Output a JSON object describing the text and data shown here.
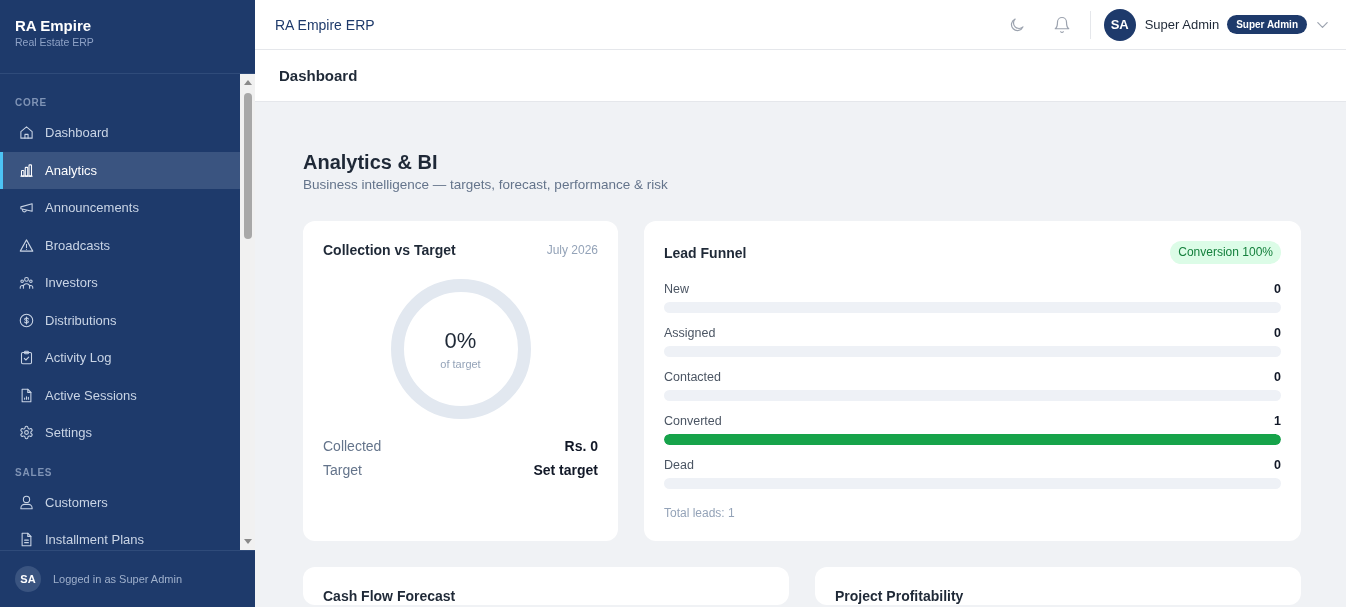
{
  "sidebar": {
    "brand": {
      "title": "RA Empire",
      "subtitle": "Real Estate ERP"
    },
    "sections": [
      {
        "label": "CORE",
        "items": [
          {
            "label": "Dashboard",
            "selected": false
          },
          {
            "label": "Analytics",
            "selected": true
          },
          {
            "label": "Announcements",
            "selected": false
          },
          {
            "label": "Broadcasts",
            "selected": false
          },
          {
            "label": "Investors",
            "selected": false
          },
          {
            "label": "Distributions",
            "selected": false
          },
          {
            "label": "Activity Log",
            "selected": false
          },
          {
            "label": "Active Sessions",
            "selected": false
          },
          {
            "label": "Settings",
            "selected": false
          }
        ]
      },
      {
        "label": "SALES",
        "items": [
          {
            "label": "Customers",
            "selected": false
          },
          {
            "label": "Installment Plans",
            "selected": false
          }
        ]
      }
    ],
    "footer": {
      "avatar": "SA",
      "text": "Logged in as Super Admin"
    }
  },
  "topbar": {
    "title": "RA Empire ERP",
    "user": {
      "avatar": "SA",
      "name": "Super Admin",
      "role": "Super Admin"
    }
  },
  "page_header": {
    "title": "Dashboard"
  },
  "content": {
    "title": "Analytics & BI",
    "subtitle": "Business intelligence — targets, forecast, performance & risk",
    "collection": {
      "title": "Collection vs Target",
      "period": "July 2026",
      "level": 0,
      "percent": "0%",
      "caption": "of target",
      "rows": [
        {
          "label": "Collected",
          "value": "Rs. 0"
        },
        {
          "label": "Target",
          "value": "Set target"
        }
      ]
    },
    "lead_funnel": {
      "title": "Lead Funnel",
      "badge": "Conversion 100%",
      "stages": [
        {
          "label": "New",
          "count": "0",
          "level": 0
        },
        {
          "label": "Assigned",
          "count": "0",
          "level": 0
        },
        {
          "label": "Contacted",
          "count": "0",
          "level": 0
        },
        {
          "label": "Converted",
          "count": "1",
          "level": 1
        },
        {
          "label": "Dead",
          "count": "0",
          "level": 0
        }
      ],
      "total": "Total leads: 1"
    },
    "cards": [
      {
        "title": "Cash Flow Forecast"
      },
      {
        "title": "Project Profitability"
      }
    ]
  }
}
